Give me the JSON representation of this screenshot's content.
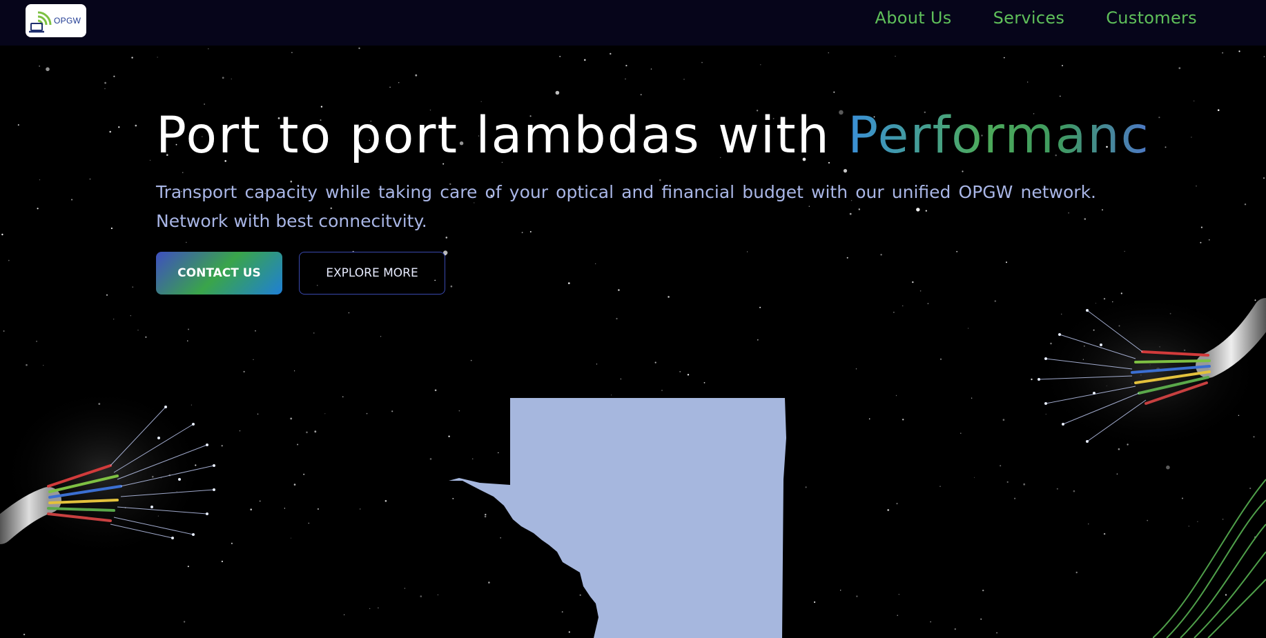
{
  "logo": {
    "text": "OPGW"
  },
  "nav": {
    "items": [
      "About Us",
      "Services",
      "Customers"
    ]
  },
  "hero": {
    "title_main": "Port to port lambdas with ",
    "title_highlight": "Performanc",
    "subtitle": "Transport capacity while taking care of your optical and financial budget with our unified OPGW network. Network with best connecitvity.",
    "contact_label": "CONTACT US",
    "explore_label": "EXPLORE MORE"
  },
  "colors": {
    "nav_bg": "#06051a",
    "nav_link": "#5fc05a",
    "subtitle": "#a9b6e6",
    "map_fill": "#a6b7de",
    "accent_blue": "#3a8fd9",
    "accent_green": "#4daa5a"
  },
  "icons": [
    "wifi-laptop-logo-icon",
    "fiber-optic-cable-icon",
    "state-map-shape"
  ]
}
